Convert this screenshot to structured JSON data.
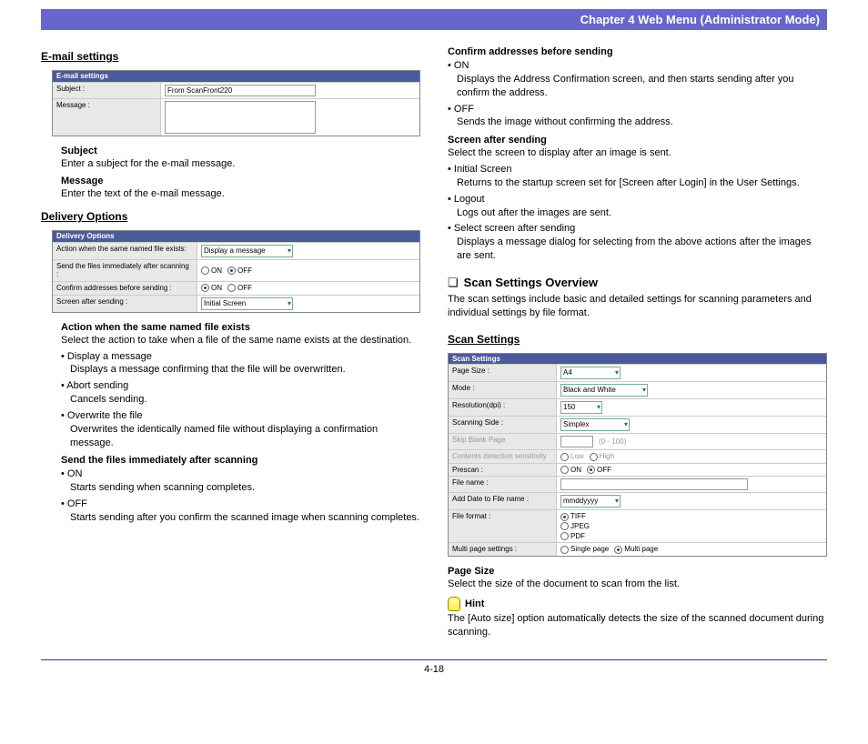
{
  "header": "Chapter 4   Web Menu (Administrator Mode)",
  "pageNumber": "4-18",
  "left": {
    "email": {
      "title": "E-mail settings",
      "shotHeader": "E-mail settings",
      "rows": {
        "subjectLabel": "Subject :",
        "subjectValue": "From ScanFront220",
        "messageLabel": "Message :"
      },
      "subject": {
        "name": "Subject",
        "desc": "Enter a subject for the e-mail message."
      },
      "message": {
        "name": "Message",
        "desc": "Enter the text of the e-mail message."
      }
    },
    "delivery": {
      "title": "Delivery Options",
      "shotHeader": "Delivery Options",
      "rows": {
        "r1l": "Action when the same named file exists:",
        "r1v": "Display a message",
        "r2l": "Send the files immediately after scanning :",
        "r2on": "ON",
        "r2off": "OFF",
        "r3l": "Confirm addresses before sending :",
        "r3on": "ON",
        "r3off": "OFF",
        "r4l": "Screen after sending :",
        "r4v": "Initial Screen"
      },
      "action": {
        "name": "Action when the same named file exists",
        "desc": "Select the action to take when a file of the same name exists at the destination.",
        "b1": "• Display a message",
        "b1d": "Displays a message confirming that the file will be overwritten.",
        "b2": "• Abort sending",
        "b2d": "Cancels sending.",
        "b3": "• Overwrite the file",
        "b3d": "Overwrites the identically named file without displaying a confirmation message."
      },
      "sendImmediate": {
        "name": "Send the files immediately after scanning",
        "b1": "• ON",
        "b1d": "Starts sending when scanning completes.",
        "b2": "• OFF",
        "b2d": "Starts sending after you confirm the scanned image when scanning completes."
      }
    }
  },
  "right": {
    "confirm": {
      "name": "Confirm addresses before sending",
      "b1": "• ON",
      "b1d": "Displays the Address Confirmation screen, and then starts sending after you confirm the address.",
      "b2": "• OFF",
      "b2d": "Sends the image without confirming the address."
    },
    "screenAfter": {
      "name": "Screen after sending",
      "desc": "Select the screen to display after an image is sent.",
      "b1": "• Initial Screen",
      "b1d": "Returns to the startup screen set for [Screen after Login] in the User Settings.",
      "b2": "• Logout",
      "b2d": "Logs out after the images are sent.",
      "b3": "• Select screen after sending",
      "b3d": "Displays a message dialog for selecting from the above actions after the images are sent."
    },
    "overview": {
      "title": "Scan Settings Overview",
      "desc": "The scan settings include basic and detailed settings for scanning parameters and individual settings by file format."
    },
    "scan": {
      "title": "Scan Settings",
      "shotHeader": "Scan Settings",
      "rows": {
        "r1l": "Page Size :",
        "r1v": "A4",
        "r2l": "Mode :",
        "r2v": "Black and White",
        "r3l": "Resolution(dpi) :",
        "r3v": "150",
        "r4l": "Scanning Side :",
        "r4v": "Simplex",
        "r5l": "   Skip Blank Page",
        "r5v": "(0 - 100)",
        "r6l": "   Contents detection sensitivity",
        "r6lo": "Low",
        "r6hi": "High",
        "r7l": "Prescan :",
        "r7on": "ON",
        "r7off": "OFF",
        "r8l": "File name :",
        "r9l": "Add Date to File name :",
        "r9v": "mmddyyyy",
        "r10l": "File format :",
        "r10a": "TIFF",
        "r10b": "JPEG",
        "r10c": "PDF",
        "r11l": "   Multi page settings :",
        "r11a": "Single page",
        "r11b": "Multi page"
      },
      "pageSize": {
        "name": "Page Size",
        "desc": "Select the size of the document to scan from the list."
      },
      "hint": {
        "label": "Hint",
        "text": "The [Auto size] option automatically detects the size of the scanned document during scanning."
      }
    }
  }
}
